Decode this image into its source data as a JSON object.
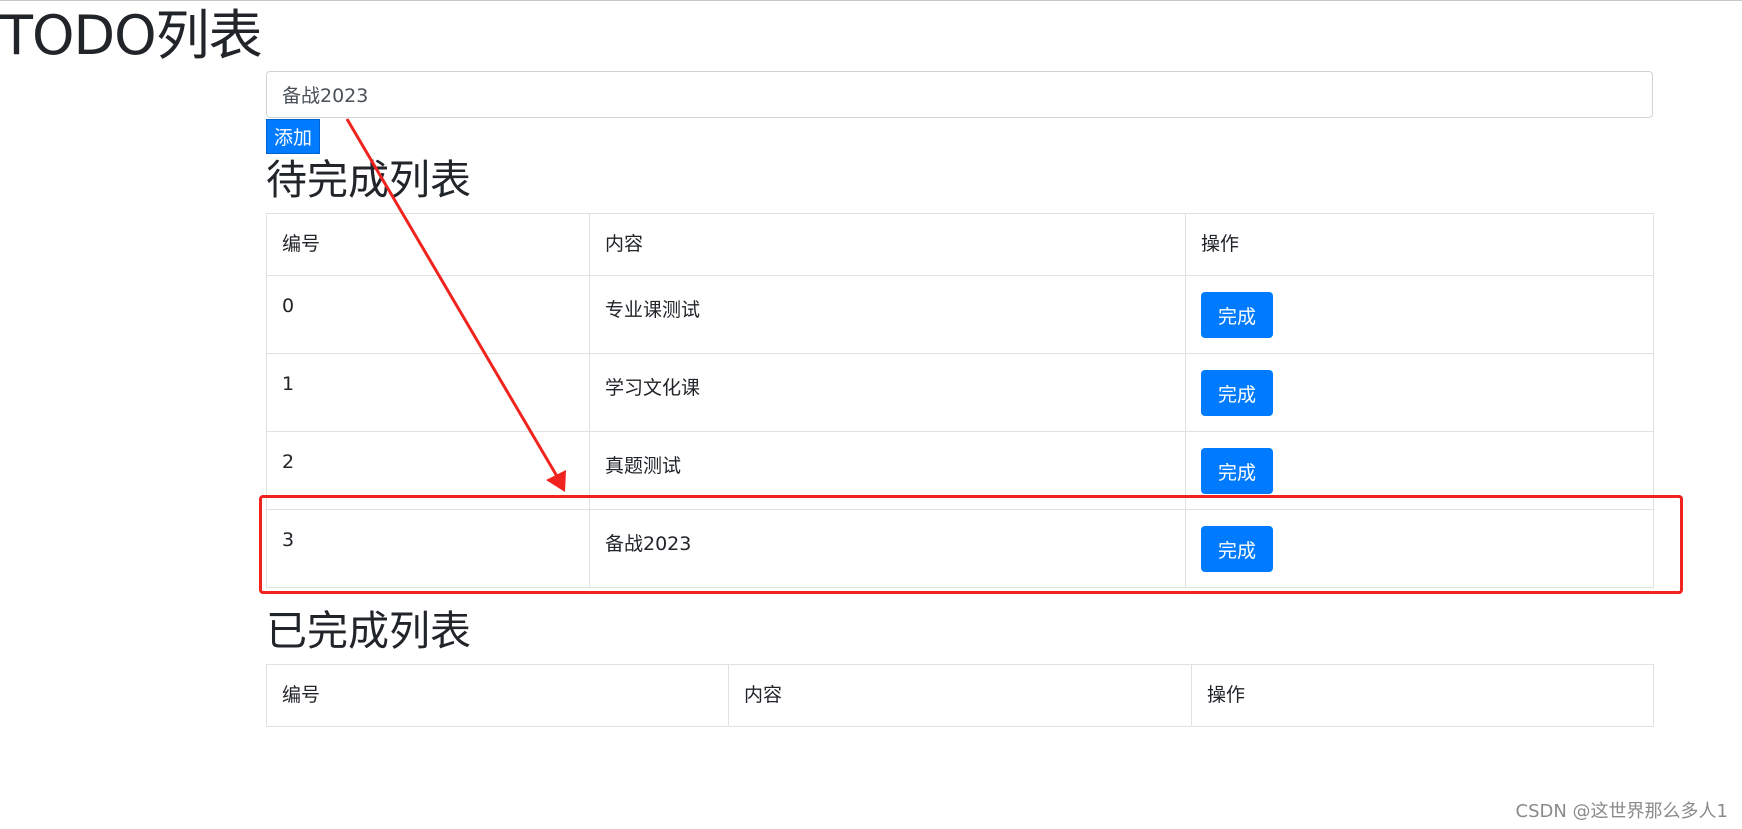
{
  "app": {
    "title": "TODO列表"
  },
  "input": {
    "value": "备战2023"
  },
  "add_button": {
    "label": "添加"
  },
  "pending": {
    "title": "待完成列表",
    "columns": [
      "编号",
      "内容",
      "操作"
    ],
    "rows": [
      {
        "id": "0",
        "content": "专业课测试",
        "action": "完成"
      },
      {
        "id": "1",
        "content": "学习文化课",
        "action": "完成"
      },
      {
        "id": "2",
        "content": "真题测试",
        "action": "完成"
      },
      {
        "id": "3",
        "content": "备战2023",
        "action": "完成"
      }
    ]
  },
  "completed": {
    "title": "已完成列表",
    "columns": [
      "编号",
      "内容",
      "操作"
    ]
  },
  "annotation": {
    "color": "#f0231e"
  },
  "watermark": "CSDN @这世界那么多人1",
  "colors": {
    "primary": "#007bff",
    "text": "#212529",
    "border": "#dee2e6"
  }
}
